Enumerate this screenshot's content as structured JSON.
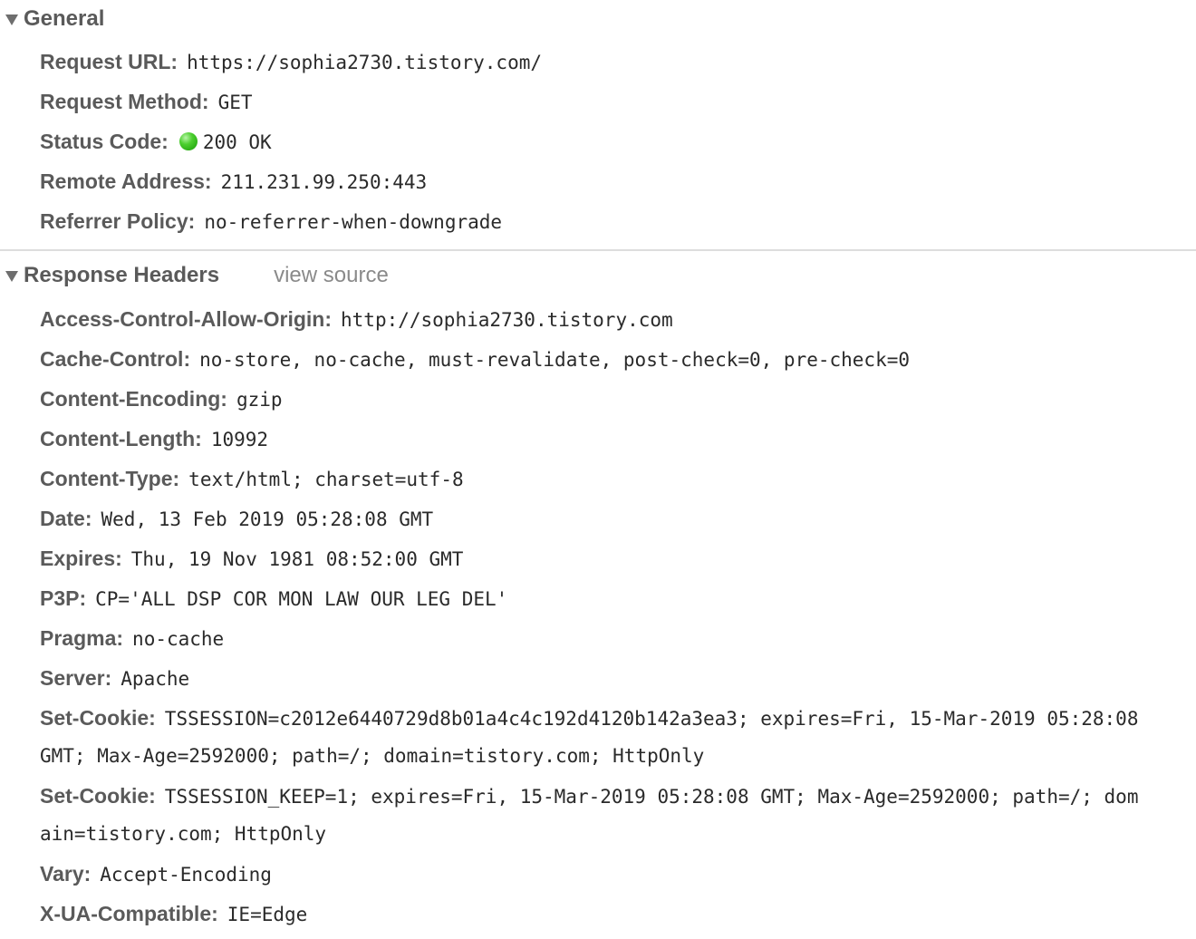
{
  "general": {
    "title": "General",
    "request_url": {
      "key": "Request URL:",
      "value": "https://sophia2730.tistory.com/"
    },
    "request_method": {
      "key": "Request Method:",
      "value": "GET"
    },
    "status_code": {
      "key": "Status Code:",
      "value": "200 OK",
      "indicator_color": "#2fb51a"
    },
    "remote_address": {
      "key": "Remote Address:",
      "value": "211.231.99.250:443"
    },
    "referrer_policy": {
      "key": "Referrer Policy:",
      "value": "no-referrer-when-downgrade"
    }
  },
  "response_headers": {
    "title": "Response Headers",
    "view_source_label": "view source",
    "headers": [
      {
        "key": "Access-Control-Allow-Origin:",
        "value": "http://sophia2730.tistory.com"
      },
      {
        "key": "Cache-Control:",
        "value": "no-store, no-cache, must-revalidate, post-check=0, pre-check=0"
      },
      {
        "key": "Content-Encoding:",
        "value": "gzip"
      },
      {
        "key": "Content-Length:",
        "value": "10992"
      },
      {
        "key": "Content-Type:",
        "value": "text/html; charset=utf-8"
      },
      {
        "key": "Date:",
        "value": "Wed, 13 Feb 2019 05:28:08 GMT"
      },
      {
        "key": "Expires:",
        "value": "Thu, 19 Nov 1981 08:52:00 GMT"
      },
      {
        "key": "P3P:",
        "value": "CP='ALL DSP COR MON LAW OUR LEG DEL'"
      },
      {
        "key": "Pragma:",
        "value": "no-cache"
      },
      {
        "key": "Server:",
        "value": "Apache"
      },
      {
        "key": "Set-Cookie:",
        "value": "TSSESSION=c2012e6440729d8b01a4c4c192d4120b142a3ea3; expires=Fri, 15-Mar-2019 05:28:08",
        "continuation": "GMT; Max-Age=2592000; path=/; domain=tistory.com; HttpOnly"
      },
      {
        "key": "Set-Cookie:",
        "value": "TSSESSION_KEEP=1; expires=Fri, 15-Mar-2019 05:28:08 GMT; Max-Age=2592000; path=/; dom",
        "continuation": "ain=tistory.com; HttpOnly"
      },
      {
        "key": "Vary:",
        "value": "Accept-Encoding"
      },
      {
        "key": "X-UA-Compatible:",
        "value": "IE=Edge"
      }
    ]
  }
}
